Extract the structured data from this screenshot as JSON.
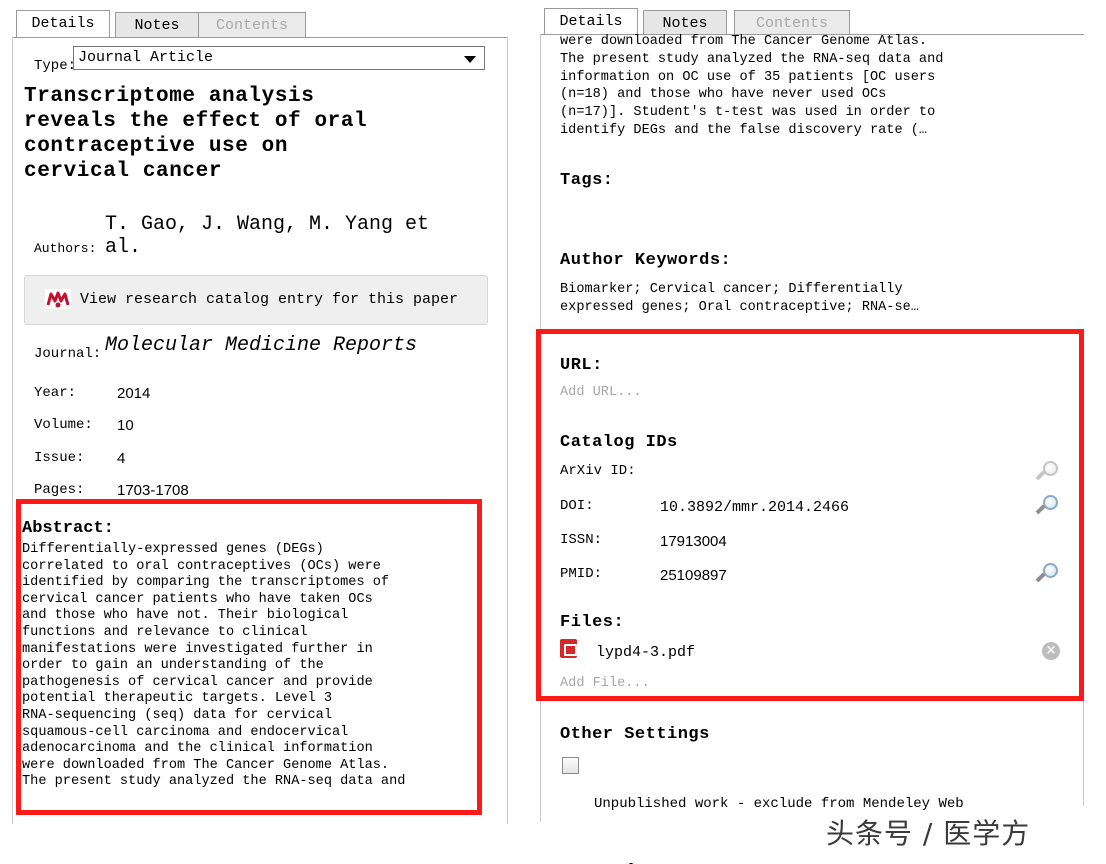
{
  "left": {
    "tabs": {
      "details": "Details",
      "notes": "Notes",
      "contents": "Contents"
    },
    "type_label": "Type:",
    "type_value": "Journal Article",
    "title_lines": [
      "Transcriptome analysis",
      "reveals the effect of oral",
      "contraceptive use on",
      "cervical cancer"
    ],
    "authors_label": "Authors:",
    "authors_lines": [
      "T. Gao, J. Wang, M. Yang et",
      "al."
    ],
    "catalog_button": "View research catalog entry for this paper",
    "journal_label": "Journal:",
    "journal_value": "Molecular Medicine Reports",
    "year_label": "Year:",
    "year_value": "2014",
    "volume_label": "Volume:",
    "volume_value": "10",
    "issue_label": "Issue:",
    "issue_value": "4",
    "pages_label": "Pages:",
    "pages_value": "1703-1708",
    "abstract_heading": "Abstract:",
    "abstract_text": "Differentially-expressed genes (DEGs)\ncorrelated to oral contraceptives (OCs) were\nidentified by comparing the transcriptomes of\ncervical cancer patients who have taken OCs\nand those who have not. Their biological\nfunctions and relevance to clinical\nmanifestations were investigated further in\norder to gain an understanding of the\npathogenesis of cervical cancer and provide\npotential therapeutic targets. Level 3\nRNA-sequencing (seq) data for cervical\nsquamous-cell carcinoma and endocervical\nadenocarcinoma and the clinical information\nwere downloaded from The Cancer Genome Atlas.\nThe present study analyzed the RNA-seq data and"
  },
  "right": {
    "tabs": {
      "details": "Details",
      "notes": "Notes",
      "contents": "Contents"
    },
    "abstract_continued": "were downloaded from The Cancer Genome Atlas.\nThe present study analyzed the RNA-seq data and\ninformation on OC use of 35 patients [OC users\n(n=18) and those who have never used OCs\n(n=17)]. Student's t-test was used in order to\nidentify DEGs and the false discovery rate (…",
    "tags_heading": "Tags:",
    "keywords_heading": "Author Keywords:",
    "keywords_text": "Biomarker; Cervical cancer; Differentially\nexpressed genes; Oral contraceptive; RNA-se…",
    "url_heading": "URL:",
    "url_placeholder": "Add URL...",
    "catalog_heading": "Catalog IDs",
    "arxiv_label": "ArXiv ID:",
    "arxiv_value": "",
    "doi_label": "DOI:",
    "doi_value": "10.3892/mmr.2014.2466",
    "issn_label": "ISSN:",
    "issn_value": "17913004",
    "pmid_label": "PMID:",
    "pmid_value": "25109897",
    "files_heading": "Files:",
    "file_name": "lypd4-3.pdf",
    "add_file_placeholder": "Add File...",
    "other_heading": "Other Settings",
    "unpublished_label_lines": [
      "Unpublished work - exclude from Mendeley Web",
      "catalog"
    ],
    "unpublished_checked": false
  },
  "watermark": "头条号 / 医学方",
  "colors": {
    "highlight_border": "#ff1a1a",
    "placeholder": "#a6a6a6",
    "pdf_icon": "#d62828"
  }
}
